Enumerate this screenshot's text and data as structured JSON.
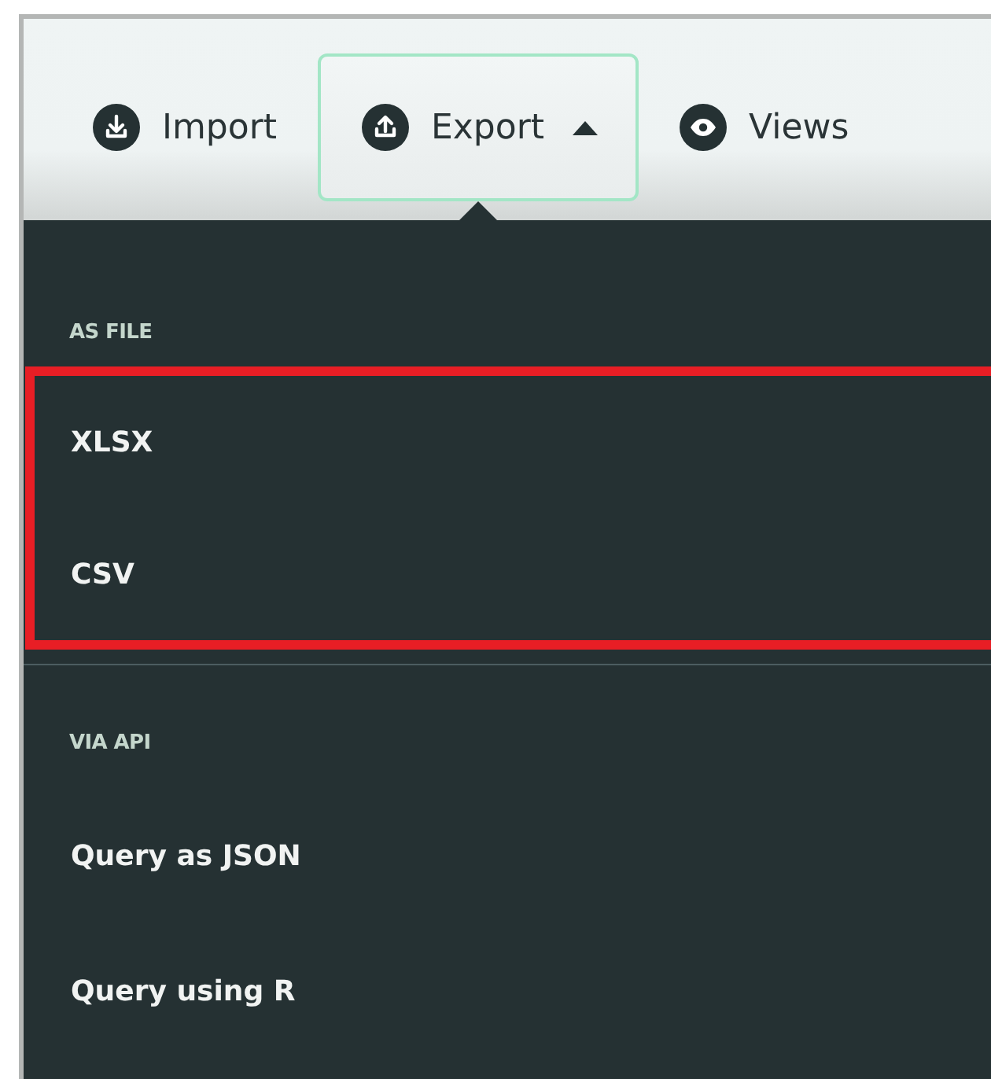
{
  "toolbar": [
    {
      "label": "Import",
      "kind": "import",
      "selected": false
    },
    {
      "label": "Export",
      "kind": "export",
      "selected": true
    },
    {
      "label": "Views",
      "kind": "views",
      "selected": false
    }
  ],
  "menu": {
    "sections": [
      {
        "header": "AS FILE",
        "highlighted": true,
        "items": [
          "XLSX",
          "CSV"
        ]
      },
      {
        "header": "VIA API",
        "highlighted": false,
        "items": [
          "Query as JSON",
          "Query using R"
        ]
      }
    ]
  }
}
